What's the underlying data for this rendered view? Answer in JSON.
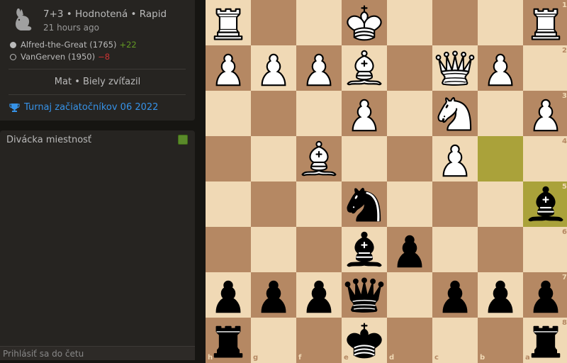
{
  "game": {
    "title": "7+3 • Hodnotená • Rapid",
    "time_ago": "21 hours ago",
    "players": [
      {
        "name": "Alfred-the-Great (1765)",
        "diff": "+22",
        "color": "white"
      },
      {
        "name": "VanGerven (1950)",
        "diff": "−8",
        "color": "black"
      }
    ],
    "result": "Mat • Biely zvíťazil",
    "tournament": "Turnaj začiatočníkov 06 2022"
  },
  "chat": {
    "title": "Divácka miestnosť",
    "input_placeholder": "Prihlásiť sa do četu"
  },
  "board": {
    "orientation": "black",
    "light_color": "#f0d9b5",
    "dark_color": "#b58863",
    "highlight_color": "#aaa23a",
    "files": [
      "h",
      "g",
      "f",
      "e",
      "d",
      "c",
      "b",
      "a"
    ],
    "ranks": [
      "1",
      "2",
      "3",
      "4",
      "5",
      "6",
      "7",
      "8"
    ],
    "last_move": [
      "b4",
      "a5"
    ],
    "pieces": [
      {
        "sq": "h1",
        "p": "wR"
      },
      {
        "sq": "e1",
        "p": "wK"
      },
      {
        "sq": "a1",
        "p": "wR"
      },
      {
        "sq": "h2",
        "p": "wP"
      },
      {
        "sq": "g2",
        "p": "wP"
      },
      {
        "sq": "f2",
        "p": "wP"
      },
      {
        "sq": "e2",
        "p": "wB"
      },
      {
        "sq": "c2",
        "p": "wQ"
      },
      {
        "sq": "b2",
        "p": "wP"
      },
      {
        "sq": "e3",
        "p": "wP"
      },
      {
        "sq": "c3",
        "p": "wN"
      },
      {
        "sq": "a3",
        "p": "wP"
      },
      {
        "sq": "f4",
        "p": "wB"
      },
      {
        "sq": "c4",
        "p": "wP"
      },
      {
        "sq": "e5",
        "p": "bN"
      },
      {
        "sq": "a5",
        "p": "bB"
      },
      {
        "sq": "e6",
        "p": "bB"
      },
      {
        "sq": "d6",
        "p": "bP"
      },
      {
        "sq": "h7",
        "p": "bP"
      },
      {
        "sq": "g7",
        "p": "bP"
      },
      {
        "sq": "f7",
        "p": "bP"
      },
      {
        "sq": "e7",
        "p": "bQ"
      },
      {
        "sq": "c7",
        "p": "bP"
      },
      {
        "sq": "b7",
        "p": "bP"
      },
      {
        "sq": "a7",
        "p": "bP"
      },
      {
        "sq": "h8",
        "p": "bR"
      },
      {
        "sq": "e8",
        "p": "bK"
      },
      {
        "sq": "a8",
        "p": "bR"
      }
    ]
  }
}
